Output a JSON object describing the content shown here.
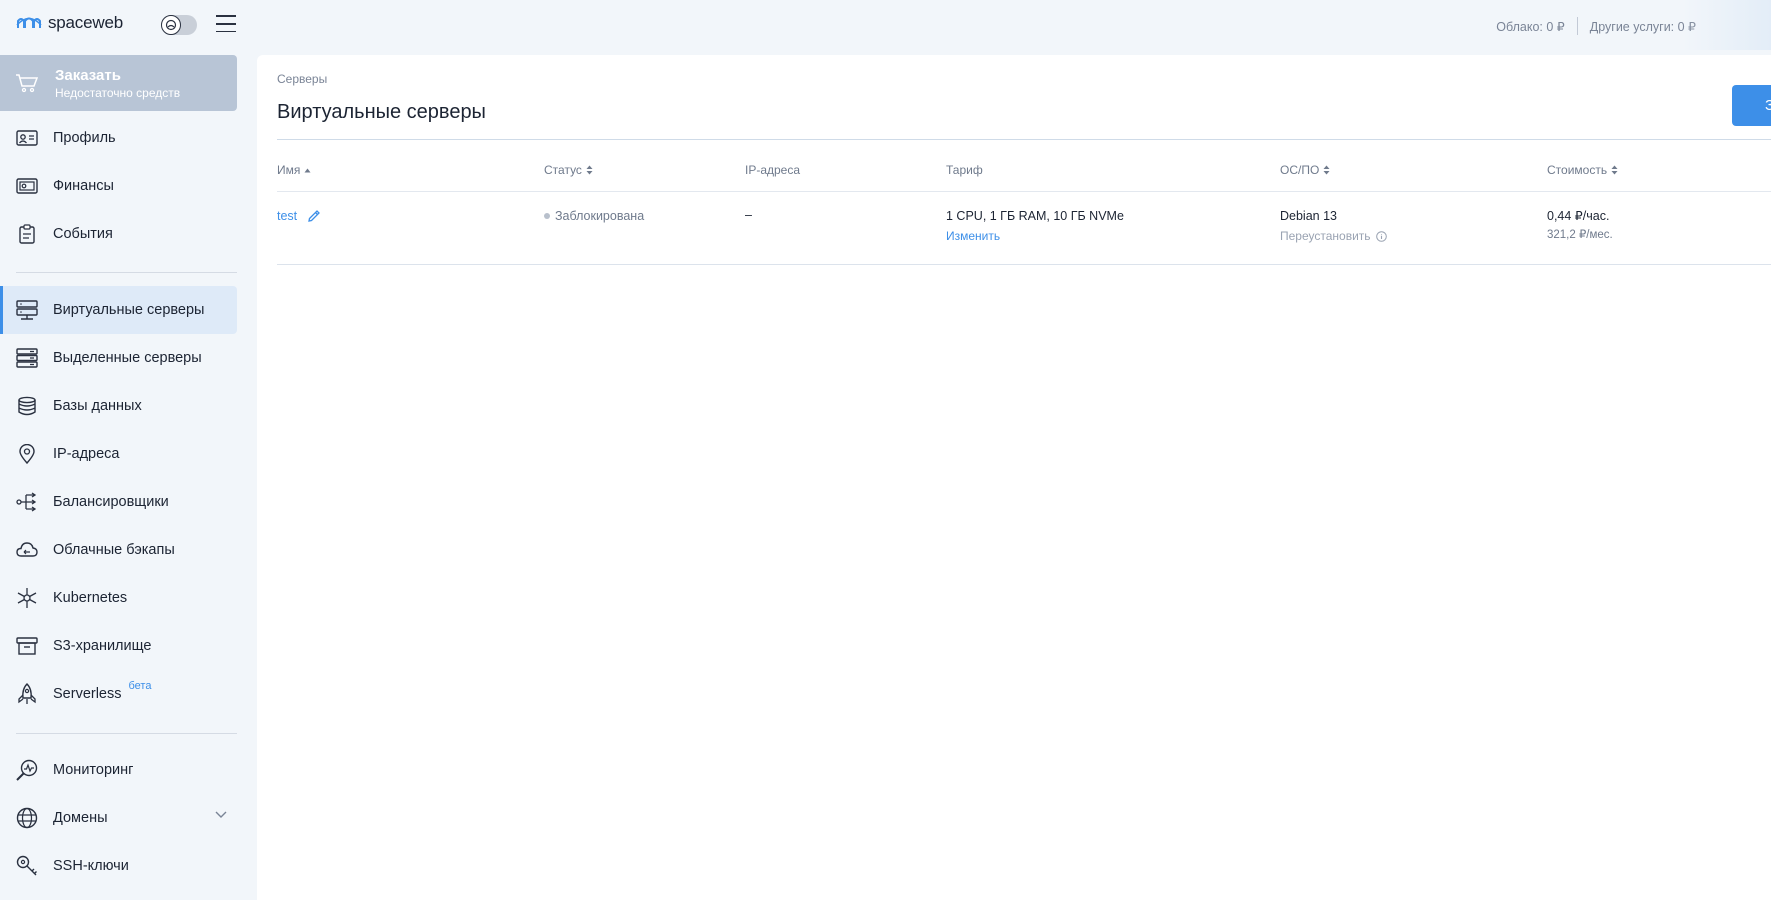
{
  "header": {
    "logo_text": "spaceweb",
    "balances": [
      {
        "label": "Облако: 0 ₽"
      },
      {
        "label": "Другие услуги: 0 ₽"
      }
    ]
  },
  "sidebar": {
    "order": {
      "title": "Заказать",
      "subtitle": "Недостаточно средств"
    },
    "items": [
      {
        "label": "Профиль",
        "icon": "profile-card-icon"
      },
      {
        "label": "Финансы",
        "icon": "wallet-icon"
      },
      {
        "label": "События",
        "icon": "clipboard-icon"
      },
      {
        "label": "Виртуальные серверы",
        "icon": "vps-icon",
        "active": true
      },
      {
        "label": "Выделенные серверы",
        "icon": "server-icon"
      },
      {
        "label": "Базы данных",
        "icon": "database-icon"
      },
      {
        "label": "IP-адреса",
        "icon": "location-pin-icon"
      },
      {
        "label": "Балансировщики",
        "icon": "balancer-icon"
      },
      {
        "label": "Облачные бэкапы",
        "icon": "cloud-backup-icon"
      },
      {
        "label": "Kubernetes",
        "icon": "kubernetes-icon"
      },
      {
        "label": "S3-хранилище",
        "icon": "storage-box-icon"
      },
      {
        "label": "Serverless",
        "icon": "rocket-icon",
        "badge": "бета"
      },
      {
        "label": "Мониторинг",
        "icon": "monitoring-icon"
      },
      {
        "label": "Домены",
        "icon": "globe-icon"
      },
      {
        "label": "SSH-ключи",
        "icon": "key-icon"
      }
    ]
  },
  "main": {
    "breadcrumb": "Серверы",
    "title": "Виртуальные серверы",
    "create_label": "З",
    "columns": [
      "Имя",
      "Статус",
      "IP-адреса",
      "Тариф",
      "ОС/ПО",
      "Стоимость"
    ],
    "rows": [
      {
        "name": "test",
        "status": "Заблокирована",
        "ip": "–",
        "tariff": "1 CPU, 1 ГБ RAM, 10 ГБ NVMe",
        "tariff_action": "Изменить",
        "os": "Debian 13",
        "os_action": "Переустановить",
        "price_hour": "0,44 ₽/час.",
        "price_month": "321,2 ₽/мес."
      }
    ]
  },
  "colors": {
    "accent": "#3d8fe8",
    "order_bg": "#b8c5d6",
    "active_bg": "#deeaf8"
  }
}
